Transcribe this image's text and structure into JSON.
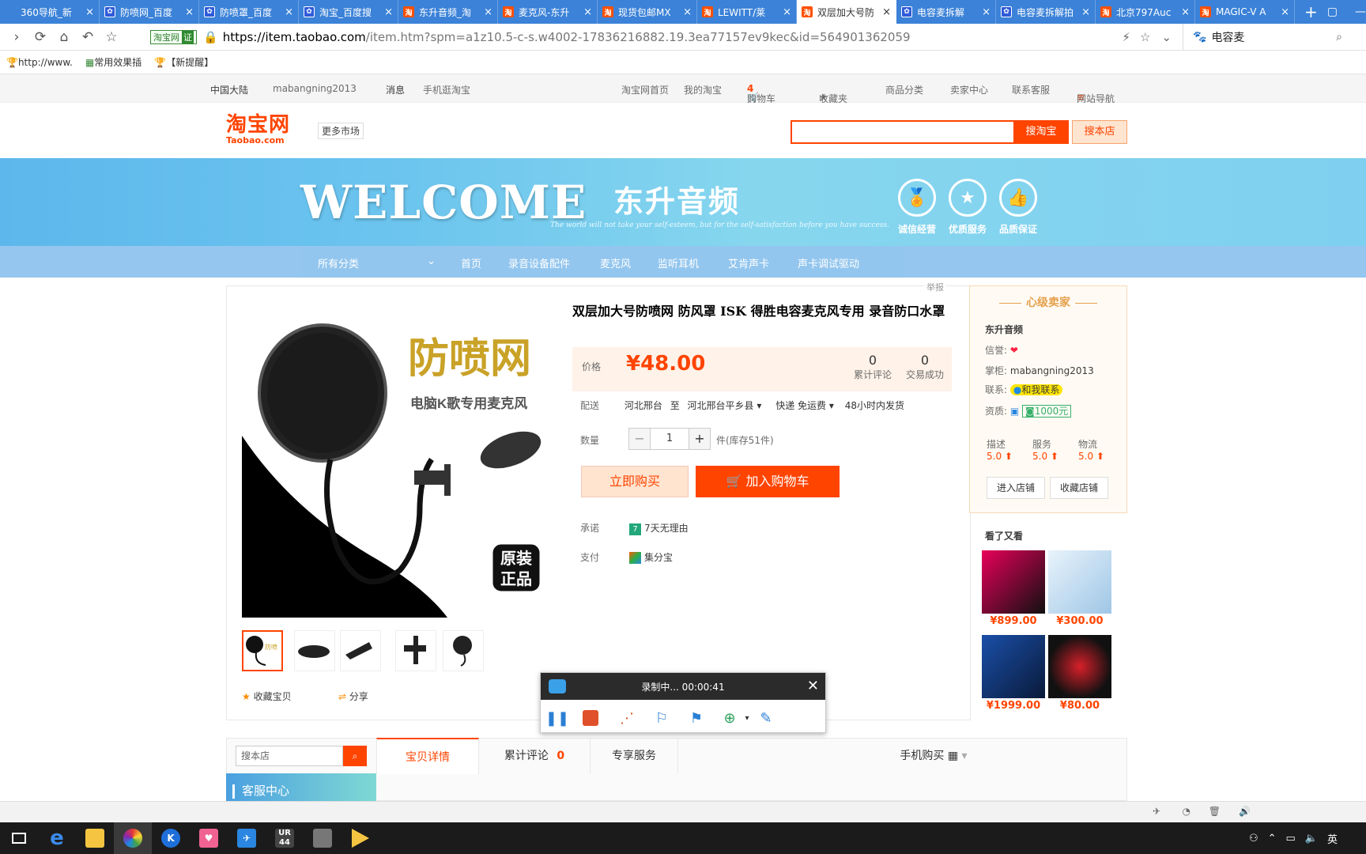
{
  "browser": {
    "tabs": [
      {
        "label": "360导航_新",
        "fav": "360"
      },
      {
        "label": "防喷网_百度",
        "fav": "baidu"
      },
      {
        "label": "防喷罩_百度",
        "fav": "baidu"
      },
      {
        "label": "淘宝_百度搜",
        "fav": "baidu"
      },
      {
        "label": "东升音频_淘",
        "fav": "taobao"
      },
      {
        "label": "麦克风-东升",
        "fav": "taobao"
      },
      {
        "label": "现货包邮MX",
        "fav": "taobao"
      },
      {
        "label": "LEWITT/莱",
        "fav": "taobao"
      },
      {
        "label": "双层加大号防",
        "fav": "taobao",
        "active": true
      },
      {
        "label": "电容麦拆解",
        "fav": "baidu"
      },
      {
        "label": "电容麦拆解拍",
        "fav": "baidu"
      },
      {
        "label": "北京797Auc",
        "fav": "taobao"
      },
      {
        "label": "MAGIC-V A",
        "fav": "taobao"
      }
    ],
    "new_tab": "+",
    "url_cert_label": "淘宝网",
    "url_cert_badge": "证",
    "url_host": "https://item.taobao.com",
    "url_path": "/item.htm?spm=a1z10.5-c-s.w4002-17836216882.19.3ea77157ev9kec&id=564901362059",
    "search_query": "电容麦",
    "bookmarks": [
      "http://www.",
      "常用效果插",
      "【新提醒】"
    ]
  },
  "site_nav": {
    "region": "中国大陆",
    "user": "mabangning2013",
    "messages": "消息",
    "mobile": "手机逛淘宝",
    "home": "淘宝网首页",
    "my_taobao": "我的淘宝",
    "cart": "购物车",
    "cart_count": "4",
    "favorites": "收藏夹",
    "categories": "商品分类",
    "seller_center": "卖家中心",
    "contact": "联系客服",
    "site_map": "网站导航"
  },
  "header": {
    "logo_cn": "淘宝网",
    "logo_en": "Taobao.com",
    "more_market": "更多市场",
    "search_btn": "搜淘宝",
    "shop_search_btn": "搜本店"
  },
  "banner": {
    "welcome": "WELCOME",
    "shop_name": "东升音频",
    "motto": "The world will not take your self-esteem, but for the self-satisfaction before you have success.",
    "badges": [
      "诚信经营",
      "优质服务",
      "品质保证"
    ]
  },
  "category_nav": [
    "所有分类",
    "首页",
    "录音设备配件",
    "麦克风",
    "监听耳机",
    "艾肯声卡",
    "声卡调试驱动"
  ],
  "product": {
    "report": "举报",
    "title": "双层加大号防喷网 防风罩 ISK 得胜电容麦克风专用 录音防口水罩",
    "image_text_1": "防喷网",
    "image_text_2": "电脑K歌专用麦克风",
    "image_badge": "原装正品",
    "price_label": "价格",
    "price": "¥48.00",
    "reviews_count": "0",
    "reviews_label": "累计评论",
    "sales_count": "0",
    "sales_label": "交易成功",
    "delivery_label": "配送",
    "delivery_from": "河北邢台",
    "delivery_to_word": "至",
    "delivery_to": "河北邢台平乡县",
    "shipping": "快递 免运费",
    "ship_time": "48小时内发货",
    "qty_label": "数量",
    "qty": "1",
    "stock": "件(库存51件)",
    "buy_now": "立即购买",
    "add_cart": "加入购物车",
    "promise_label": "承诺",
    "promise": "7天无理由",
    "pay_label": "支付",
    "pay": "集分宝",
    "fav_item": "收藏宝贝",
    "share": "分享"
  },
  "seller": {
    "heading": "心级卖家",
    "shop": "东升音频",
    "credit_label": "信誉:",
    "keeper_label": "掌柜:",
    "keeper": "mabangning2013",
    "contact_label": "联系:",
    "contact_btn": "和我联系",
    "qual_label": "资质:",
    "deposit": "1000元",
    "scores": [
      {
        "label": "描述",
        "value": "5.0"
      },
      {
        "label": "服务",
        "value": "5.0"
      },
      {
        "label": "物流",
        "value": "5.0"
      }
    ],
    "enter_shop": "进入店铺",
    "fav_shop": "收藏店铺",
    "also_viewed": "看了又看",
    "recs": [
      "¥899.00",
      "¥300.00",
      "¥1999.00",
      "¥80.00"
    ]
  },
  "recorder": {
    "status": "录制中... 00:00:41"
  },
  "detail_tabs": {
    "shop_search_placeholder": "搜本店",
    "kefu": "客服中心",
    "details": "宝贝详情",
    "reviews": "累计评论",
    "reviews_count": "0",
    "service": "专享服务",
    "mobile_buy": "手机购买"
  },
  "taskbar": {
    "ime": "英"
  }
}
